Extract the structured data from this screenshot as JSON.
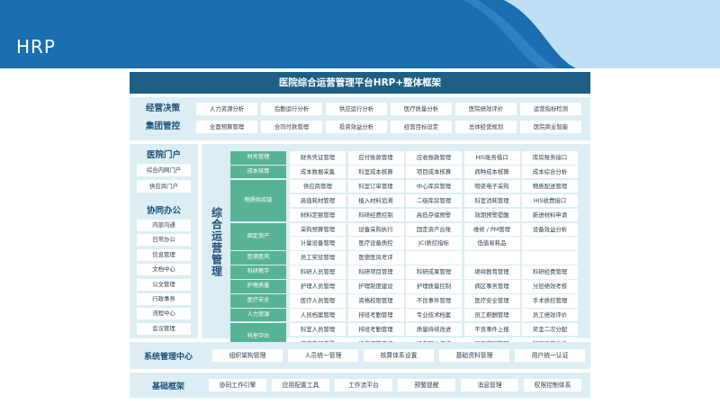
{
  "page_title": "HRP",
  "framework_title": "医院综合运营管理平台HRP+整体框架",
  "top_section": {
    "rows": [
      {
        "label": "经营决策",
        "items": [
          "人力资源分析",
          "后勤运行分析",
          "供应运行分析",
          "医疗质量分析",
          "医院绩效评价",
          "运营指标检测"
        ]
      },
      {
        "label": "集团管控",
        "items": [
          "全面预算管理",
          "合同付款管理",
          "投资效益分析",
          "经营目标设定",
          "总体经营规划",
          "医院商业智能"
        ]
      }
    ]
  },
  "left_section": {
    "portal_title": "医院门户",
    "portal_items": [
      "综合内网门户",
      "供应商门户"
    ],
    "office_title": "协同办公",
    "office_items": [
      "内部沟通",
      "日常办公",
      "信息管理",
      "文档中心",
      "公文管理",
      "行政事务",
      "流程中心",
      "会议管理"
    ]
  },
  "center_section": {
    "title": "综合运营管理",
    "groups": [
      {
        "label": "财务管理",
        "rows": [
          [
            "财务凭证管理",
            "应付账款管理",
            "应收账款管理",
            "HIS账务借口",
            "库房账务接口"
          ]
        ]
      },
      {
        "label": "成本核算",
        "rows": [
          [
            "成本数据采集",
            "科室成本核算",
            "项目成本核算",
            "病种成本核算",
            "成本综合分析"
          ]
        ]
      },
      {
        "label": "物质供应链",
        "rows": [
          [
            "供应商管理",
            "科室订单管理",
            "中心库房管理",
            "物资电子采购",
            "物质配送管理"
          ],
          [
            "高值耗材管理",
            "植入材料追溯",
            "二级库房管理",
            "科室消耗管理",
            "HIS收费接口"
          ],
          [
            "材料定额管理",
            "科研经费控制",
            "高低存储预警",
            "效期预警提醒",
            "新进材料申请"
          ]
        ]
      },
      {
        "label": "固定资产",
        "rows": [
          [
            "采购预算管理",
            "设备采购执行",
            "固定资产台账",
            "维修 / PM管理",
            "设备效益分析"
          ],
          [
            "计量设备管理",
            "医疗设备质控",
            "JCI质控指标",
            "低值易耗品",
            ""
          ]
        ]
      },
      {
        "label": "医德医风",
        "rows": [
          [
            "员工奖惩管理",
            "医德医风考评",
            "",
            "",
            ""
          ]
        ]
      },
      {
        "label": "科研教学",
        "rows": [
          [
            "科研人员管理",
            "科研项目管理",
            "科研成果管理",
            "继续教育管理",
            "科研经费管理"
          ]
        ]
      },
      {
        "label": "护理质量",
        "rows": [
          [
            "护理人员管理",
            "护理制度建设",
            "护理质量控制",
            "病区事务管理",
            "分层绩效考核"
          ]
        ]
      },
      {
        "label": "医疗安全",
        "rows": [
          [
            "医疗人员管理",
            "资格权限管理",
            "不良事件管理",
            "医疗安全管理",
            "手术质控管理"
          ]
        ]
      },
      {
        "label": "人力资源",
        "rows": [
          [
            "人员档案管理",
            "排班考勤管理",
            "专业技术档案",
            "员工薪酬管理",
            "员工绩效评价"
          ]
        ]
      },
      {
        "label": "科室中台",
        "rows": [
          [
            "科室人员管理",
            "排班考勤管理",
            "质量持续改进",
            "不良事件上报",
            "奖金二次分配"
          ],
          [
            "物资申领申购",
            "设备预算申报",
            "设备网上报修",
            "员工薪酬管理",
            "科室运营分析"
          ]
        ]
      }
    ]
  },
  "system_section": {
    "label": "系统管理中心",
    "items": [
      "组织架构管理",
      "人员统一管理",
      "核算体系设置",
      "基础资料管理",
      "用户统一认证"
    ]
  },
  "base_section": {
    "label": "基础框架",
    "items": [
      "协同工作引擎",
      "应用配置工具",
      "工作流平台",
      "预警提醒",
      "消息管理",
      "权限控制体系"
    ]
  },
  "colors": {
    "title_bar": "#1d5f86",
    "panel_bg": "#dceef3",
    "sub_label": "#58b396",
    "label_text": "#1d4f7a",
    "header_blue": "#1a6fb0",
    "header_light": "#bfe0f4"
  }
}
